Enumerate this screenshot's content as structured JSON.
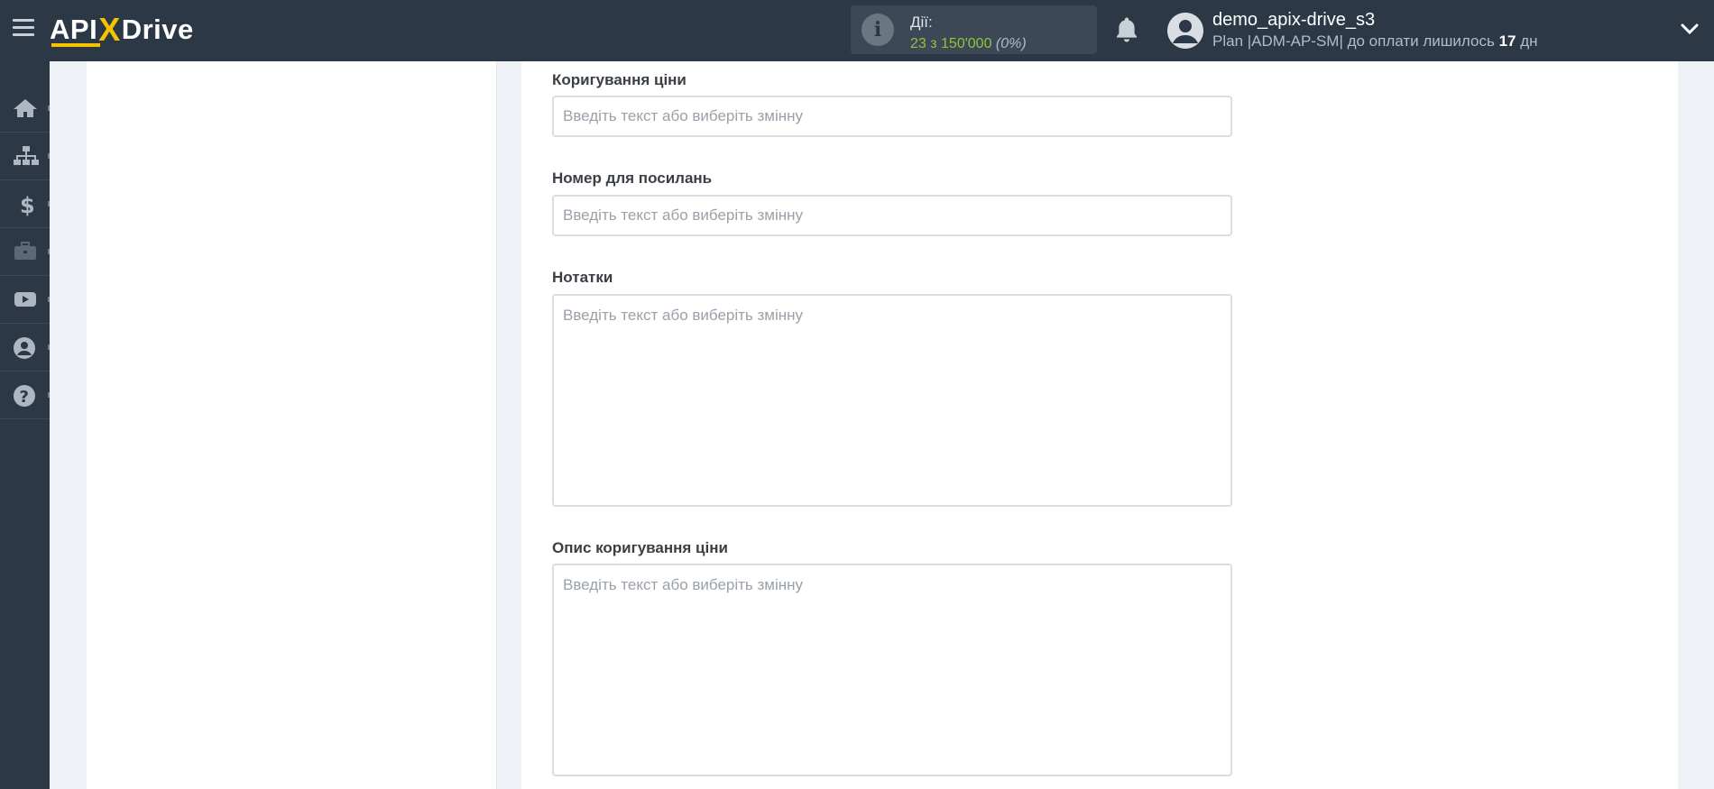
{
  "app": {
    "logo_api": "API",
    "logo_x": "X",
    "logo_drive": "Drive"
  },
  "header": {
    "actions_title": "Дії:",
    "actions_count": "23 з 150'000",
    "actions_percent": "(0%)",
    "username": "demo_apix-drive_s3",
    "plan_text": "Plan |ADM-AP-SM| до оплати лишилось",
    "plan_days": "17",
    "plan_days_unit": "дн"
  },
  "sidebar": {
    "items": [
      {
        "icon": "home-icon"
      },
      {
        "icon": "sitemap-icon"
      },
      {
        "icon": "dollar-icon"
      },
      {
        "icon": "briefcase-icon"
      },
      {
        "icon": "youtube-icon"
      },
      {
        "icon": "user-circle-icon"
      },
      {
        "icon": "question-icon"
      }
    ]
  },
  "form": {
    "fields": [
      {
        "label": "Коригування ціни",
        "placeholder": "Введіть текст або виберіть змінну"
      },
      {
        "label": "Номер для посилань",
        "placeholder": "Введіть текст або виберіть змінну"
      },
      {
        "label": "Нотатки",
        "placeholder": "Введіть текст або виберіть змінну"
      },
      {
        "label": "Опис коригування ціни",
        "placeholder": "Введіть текст або виберіть змінну"
      }
    ]
  },
  "colors": {
    "topbar": "#2d3846",
    "accent_yellow": "#f5c300",
    "actions_green": "#8fc43c"
  }
}
